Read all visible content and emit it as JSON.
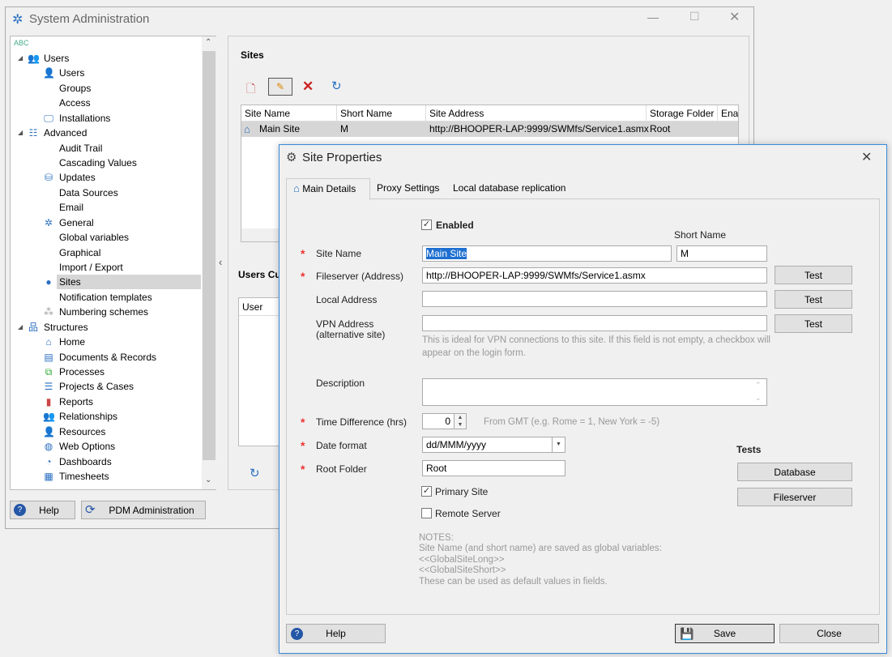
{
  "main_window": {
    "title": "System Administration",
    "title_icon": "gear-icon"
  },
  "tree": {
    "search_icon": "abc-filter-icon",
    "items": [
      {
        "label": "Users",
        "level": 0,
        "icon": "users-group-icon",
        "expanded": true
      },
      {
        "label": "Users",
        "level": 1,
        "icon": "user-icon"
      },
      {
        "label": "Groups",
        "level": 1
      },
      {
        "label": "Access",
        "level": 1
      },
      {
        "label": "Installations",
        "level": 1,
        "icon": "monitor-icon"
      },
      {
        "label": "Advanced",
        "level": 0,
        "icon": "advanced-icon",
        "expanded": true
      },
      {
        "label": "Audit Trail",
        "level": 1
      },
      {
        "label": "Cascading Values",
        "level": 1
      },
      {
        "label": "Updates",
        "level": 1,
        "icon": "database-icon"
      },
      {
        "label": "Data Sources",
        "level": 1
      },
      {
        "label": "Email",
        "level": 1
      },
      {
        "label": "General",
        "level": 1,
        "icon": "gear-icon"
      },
      {
        "label": "Global variables",
        "level": 1
      },
      {
        "label": "Graphical",
        "level": 1
      },
      {
        "label": "Import / Export",
        "level": 1
      },
      {
        "label": "Sites",
        "level": 1,
        "icon": "globe-icon",
        "selected": true
      },
      {
        "label": "Notification templates",
        "level": 1
      },
      {
        "label": "Numbering schemes",
        "level": 1,
        "icon": "numbering-icon"
      },
      {
        "label": "Structures",
        "level": 0,
        "icon": "hierarchy-icon",
        "expanded": true
      },
      {
        "label": "Home",
        "level": 1,
        "icon": "home-icon"
      },
      {
        "label": "Documents & Records",
        "level": 1,
        "icon": "document-icon"
      },
      {
        "label": "Processes",
        "level": 1,
        "icon": "process-icon"
      },
      {
        "label": "Projects & Cases",
        "level": 1,
        "icon": "gantt-icon"
      },
      {
        "label": "Reports",
        "level": 1,
        "icon": "bar-chart-icon"
      },
      {
        "label": "Relationships",
        "level": 1,
        "icon": "relationships-icon"
      },
      {
        "label": "Resources",
        "level": 1,
        "icon": "resources-icon"
      },
      {
        "label": "Web Options",
        "level": 1,
        "icon": "web-icon"
      },
      {
        "label": "Dashboards",
        "level": 1,
        "icon": "dashboard-icon"
      },
      {
        "label": "Timesheets",
        "level": 1,
        "icon": "timesheet-icon"
      }
    ]
  },
  "footer": {
    "help": "Help",
    "pdm": "PDM Administration"
  },
  "sites": {
    "title": "Sites",
    "toolbar": [
      "new-icon",
      "edit-icon",
      "delete-icon",
      "refresh-icon"
    ],
    "columns": [
      "Site Name",
      "Short Name",
      "Site Address",
      "Storage Folder",
      "Enab"
    ],
    "rows": [
      {
        "name": "Main Site",
        "short": "M",
        "address": "http://BHOOPER-LAP:9999/SWMfs/Service1.asmx",
        "folder": "Root"
      }
    ]
  },
  "users_section": {
    "title": "Users Cu",
    "column": "User"
  },
  "dialog": {
    "title": "Site Properties",
    "tabs": [
      "Main Details",
      "Proxy Settings",
      "Local database replication"
    ],
    "enabled_label": "Enabled",
    "enabled": true,
    "short_name_label": "Short Name",
    "site_name_label": "Site Name",
    "site_name": "Main Site",
    "short_name": "M",
    "fileserver_label": "Fileserver (Address)",
    "fileserver": "http://BHOOPER-LAP:9999/SWMfs/Service1.asmx",
    "local_label": "Local Address",
    "local": "",
    "vpn_label": "VPN Address",
    "vpn_label2": "(alternative site)",
    "vpn": "",
    "vpn_hint": "This is ideal for VPN connections to this site. If this field is not empty,  a checkbox will appear on the login form.",
    "test": "Test",
    "description_label": "Description",
    "description": "",
    "time_label": "Time Difference (hrs)",
    "time": "0",
    "time_hint": "From GMT (e.g. Rome = 1, New York = -5)",
    "date_label": "Date format",
    "date": "dd/MMM/yyyy",
    "root_label": "Root Folder",
    "root": "Root",
    "primary_label": "Primary Site",
    "primary": true,
    "remote_label": "Remote Server",
    "remote": false,
    "tests_title": "Tests",
    "db_btn": "Database",
    "fs_btn": "Fileserver",
    "notes": [
      "NOTES:",
      "Site Name (and short name) are saved as global variables:",
      "<<GlobalSiteLong>>",
      "<<GlobalSiteShort>>",
      "These can be used as default values in fields."
    ],
    "help": "Help",
    "save": "Save",
    "close": "Close"
  },
  "colors": {
    "accent": "#0078d7",
    "required": "#e33333",
    "selection": "#d6d6d6"
  }
}
